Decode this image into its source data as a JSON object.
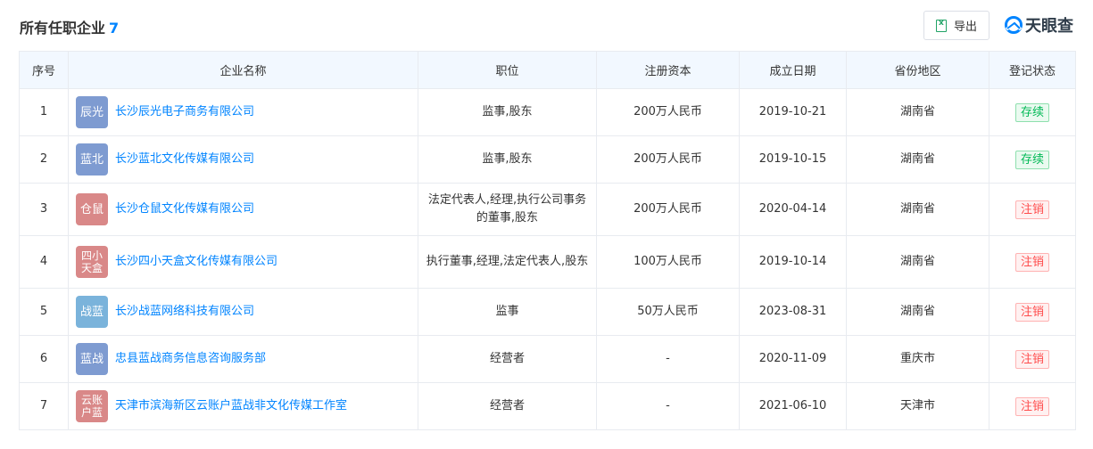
{
  "header": {
    "title": "所有任职企业",
    "count": "7",
    "export_label": "导出",
    "logo_text": "天眼查"
  },
  "columns": [
    "序号",
    "企业名称",
    "职位",
    "注册资本",
    "成立日期",
    "省份地区",
    "登记状态"
  ],
  "rows": [
    {
      "index": "1",
      "avatar": "辰光",
      "avatar_color": "#7e9bd1",
      "name": "长沙辰光电子商务有限公司",
      "position": "监事,股东",
      "capital": "200万人民币",
      "date": "2019-10-21",
      "region": "湖南省",
      "status": "存续",
      "status_type": "active"
    },
    {
      "index": "2",
      "avatar": "蓝北",
      "avatar_color": "#7e9bd1",
      "name": "长沙蓝北文化传媒有限公司",
      "position": "监事,股东",
      "capital": "200万人民币",
      "date": "2019-10-15",
      "region": "湖南省",
      "status": "存续",
      "status_type": "active"
    },
    {
      "index": "3",
      "avatar": "仓鼠",
      "avatar_color": "#d98888",
      "name": "长沙仓鼠文化传媒有限公司",
      "position": "法定代表人,经理,执行公司事务的董事,股东",
      "capital": "200万人民币",
      "date": "2020-04-14",
      "region": "湖南省",
      "status": "注销",
      "status_type": "cancel"
    },
    {
      "index": "4",
      "avatar": "四小天盒",
      "avatar_color": "#d98888",
      "name": "长沙四小天盒文化传媒有限公司",
      "position": "执行董事,经理,法定代表人,股东",
      "capital": "100万人民币",
      "date": "2019-10-14",
      "region": "湖南省",
      "status": "注销",
      "status_type": "cancel"
    },
    {
      "index": "5",
      "avatar": "战蓝",
      "avatar_color": "#7ab3db",
      "name": "长沙战蓝网络科技有限公司",
      "position": "监事",
      "capital": "50万人民币",
      "date": "2023-08-31",
      "region": "湖南省",
      "status": "注销",
      "status_type": "cancel"
    },
    {
      "index": "6",
      "avatar": "蓝战",
      "avatar_color": "#7e9bd1",
      "name": "忠县蓝战商务信息咨询服务部",
      "position": "经营者",
      "capital": "-",
      "date": "2020-11-09",
      "region": "重庆市",
      "status": "注销",
      "status_type": "cancel"
    },
    {
      "index": "7",
      "avatar": "云账户蓝",
      "avatar_color": "#d98888",
      "name": "天津市滨海新区云账户蓝战非文化传媒工作室",
      "position": "经营者",
      "capital": "-",
      "date": "2021-06-10",
      "region": "天津市",
      "status": "注销",
      "status_type": "cancel"
    }
  ]
}
